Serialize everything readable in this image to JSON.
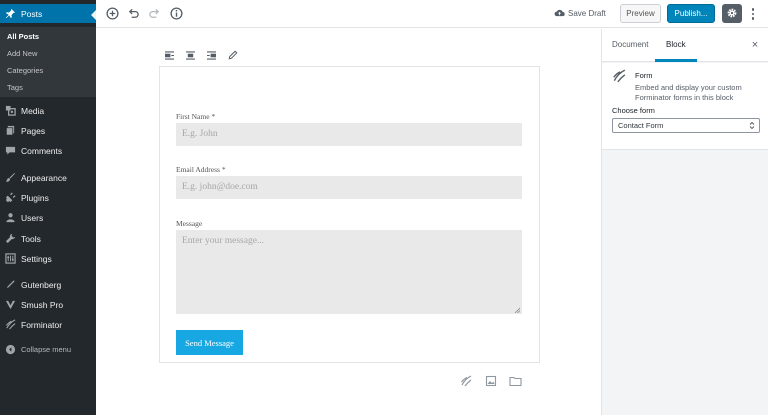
{
  "sidebar": {
    "menu_top": {
      "label": "Posts",
      "icon": "pin-icon"
    },
    "submenu": [
      {
        "label": "All Posts",
        "current": true
      },
      {
        "label": "Add New",
        "current": false
      },
      {
        "label": "Categories",
        "current": false
      },
      {
        "label": "Tags",
        "current": false
      }
    ],
    "items": [
      {
        "label": "Media",
        "icon": "media-icon"
      },
      {
        "label": "Pages",
        "icon": "pages-icon"
      },
      {
        "label": "Comments",
        "icon": "comment-icon"
      },
      {
        "label": "Appearance",
        "icon": "paintbrush-icon"
      },
      {
        "label": "Plugins",
        "icon": "plugin-icon"
      },
      {
        "label": "Users",
        "icon": "users-icon"
      },
      {
        "label": "Tools",
        "icon": "wrench-icon"
      },
      {
        "label": "Settings",
        "icon": "settings-icon"
      },
      {
        "label": "Gutenberg",
        "icon": "gutenberg-icon"
      },
      {
        "label": "Smush Pro",
        "icon": "smush-icon"
      },
      {
        "label": "Forminator",
        "icon": "forminator-icon"
      }
    ],
    "collapse": {
      "label": "Collapse menu",
      "icon": "collapse-icon"
    }
  },
  "toolbar": {
    "save_draft": "Save Draft",
    "preview": "Preview",
    "publish": "Publish..."
  },
  "form": {
    "first_name_label": "First Name *",
    "first_name_placeholder": "E.g. John",
    "email_label": "Email Address *",
    "email_placeholder": "E.g. john@doe.com",
    "message_label": "Message",
    "message_placeholder": "Enter your message...",
    "submit_label": "Send Message"
  },
  "settings": {
    "tab_document": "Document",
    "tab_block": "Block",
    "active_tab": "Block",
    "close_glyph": "×",
    "block_title": "Form",
    "block_description": "Embed and display your custom Forminator forms in this block",
    "choose_form_label": "Choose form",
    "selected_form": "Contact Form"
  },
  "colors": {
    "admin_bar": "#23282d",
    "admin_active": "#0073aa",
    "publish": "#0085ba",
    "submit_button": "#17a8e3",
    "input_bg": "#e9e9e9"
  }
}
